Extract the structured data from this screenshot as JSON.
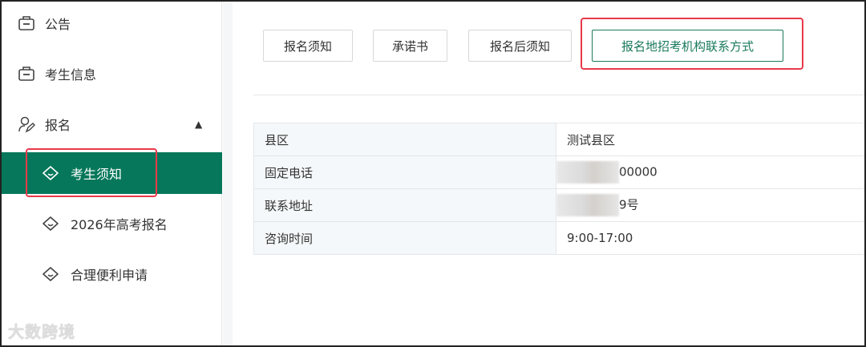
{
  "sidebar": {
    "items": [
      {
        "label": "公告",
        "icon": "briefcase-icon"
      },
      {
        "label": "考生信息",
        "icon": "briefcase-icon"
      },
      {
        "label": "报名",
        "icon": "user-edit-icon",
        "expanded": true
      }
    ],
    "sub_items": [
      {
        "label": "考生须知",
        "active": true
      },
      {
        "label": "2026年高考报名"
      },
      {
        "label": "合理便利申请"
      }
    ],
    "watermark": "大数跨境"
  },
  "tabs": [
    {
      "label": "报名须知"
    },
    {
      "label": "承诺书"
    },
    {
      "label": "报名后须知"
    },
    {
      "label": "报名地招考机构联系方式",
      "active": true
    }
  ],
  "table": {
    "rows": [
      {
        "key": "县区",
        "value": "测试县区"
      },
      {
        "key": "固定电话",
        "value": "00000",
        "redacted": true
      },
      {
        "key": "联系地址",
        "value": "9号",
        "redacted": true
      },
      {
        "key": "咨询时间",
        "value": "9:00-17:00"
      }
    ]
  },
  "colors": {
    "accent": "#06775a",
    "highlight": "#e8394a"
  }
}
